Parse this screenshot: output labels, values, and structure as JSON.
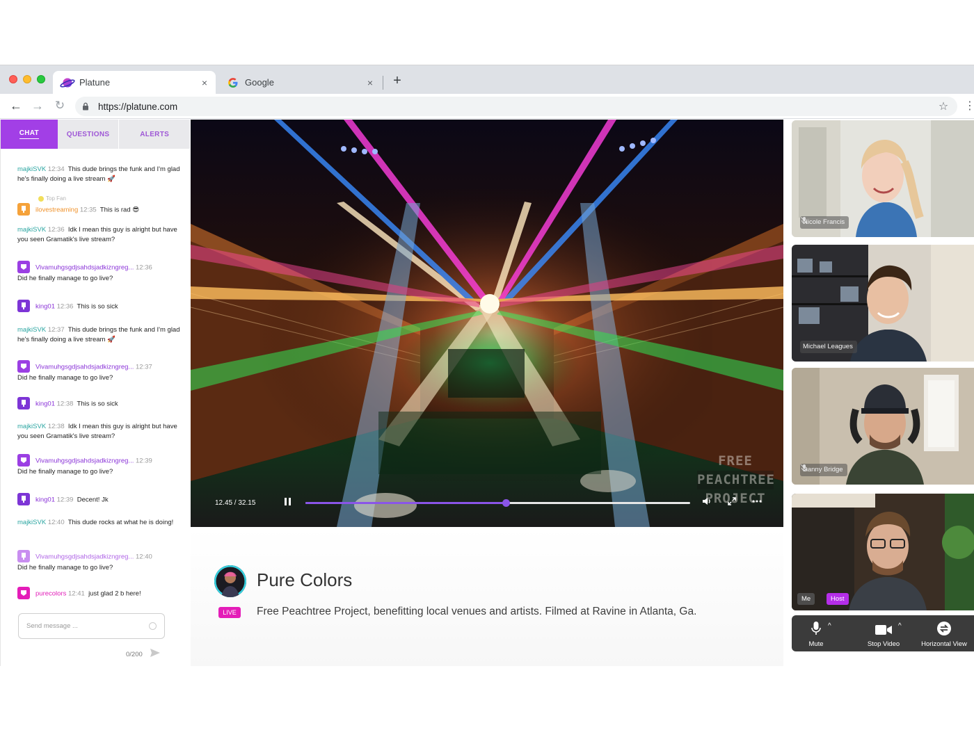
{
  "browser": {
    "tabs": [
      {
        "title": "Platune",
        "close": "×"
      },
      {
        "title": "Google",
        "close": "×"
      }
    ],
    "new_tab": "+",
    "url": "https://platune.com"
  },
  "chat": {
    "tabs": [
      "CHAT",
      "QUESTIONS",
      "ALERTS"
    ],
    "messages": [
      {
        "user": "majkiSVK",
        "time": "12:34",
        "text": "This dude brings the funk and I'm glad he's finally doing a live stream 🚀"
      },
      {
        "top_fan": "Top Fan",
        "user": "ilovestreaming",
        "time": "12:35",
        "text": "This is rad 😎"
      },
      {
        "user": "majkiSVK",
        "time": "12:36",
        "text": "Idk I mean this guy is alright but have you seen Gramatik's live stream?"
      },
      {
        "user": "Vivamuhgsgdjsahdsjadkizngreg...",
        "time": "12:36",
        "text": "Did he finally manage to go live?"
      },
      {
        "user": "king01",
        "time": "12:36",
        "text": "This is so sick"
      },
      {
        "user": "majkiSVK",
        "time": "12:37",
        "text": "This dude brings the funk and I'm glad he's finally doing a live stream 🚀"
      },
      {
        "user": "Vivamuhgsgdjsahdsjadkizngreg...",
        "time": "12:37",
        "text": "Did he finally manage to go live?"
      },
      {
        "user": "king01",
        "time": "12:38",
        "text": "This is so sick"
      },
      {
        "user": "majkiSVK",
        "time": "12:38",
        "text": "Idk I mean this guy is alright but have you seen Gramatik's live stream?"
      },
      {
        "user": "Vivamuhgsgdjsahdsjadkizngreg...",
        "time": "12:39",
        "text": "Did he finally manage to go live?"
      },
      {
        "user": "king01",
        "time": "12:39",
        "text": "Decent! Jk"
      },
      {
        "user": "majkiSVK",
        "time": "12:40",
        "text": "This dude rocks at what he is doing!"
      },
      {
        "user": "Vivamuhgsgdjsahdsjadkizngreg...",
        "time": "12:40",
        "text": "Did he finally manage to go live?"
      },
      {
        "user": "purecolors",
        "time": "12:41",
        "text": "just glad 2 b here!"
      }
    ],
    "input_placeholder": "Send message ...",
    "counter": "0/200"
  },
  "player": {
    "time": "12.45 / 32.15",
    "progress": 0.52,
    "watermark": [
      "FREE",
      "PEACHTREE",
      "PROJECT"
    ]
  },
  "stream": {
    "title": "Pure Colors",
    "badge": "LIVE",
    "description": "Free Peachtree Project, benefitting local venues and artists. Filmed at Ravine in Atlanta, Ga."
  },
  "participants": [
    {
      "name": "Nicole Francis",
      "muted": true
    },
    {
      "name": "Michael Leagues",
      "muted": false
    },
    {
      "name": "Danny Bridge",
      "muted": true
    },
    {
      "name": "Me",
      "role": "Host"
    }
  ],
  "call_controls": {
    "mute": "Mute",
    "stop_video": "Stop Video",
    "view": "Horizontal View",
    "caret": "^"
  },
  "colors": {
    "accent": "#a23fe6",
    "teal_user": "#2aa5a1",
    "live": "#e41db8",
    "progress": "#8a55e8"
  }
}
